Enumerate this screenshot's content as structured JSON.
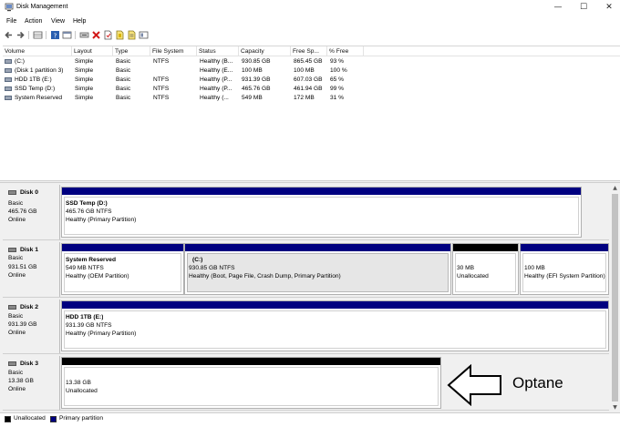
{
  "window": {
    "title": "Disk Management",
    "min_glyph": "—",
    "max_glyph": "☐",
    "close_glyph": "✕"
  },
  "menu": [
    "File",
    "Action",
    "View",
    "Help"
  ],
  "toolbar": {
    "icons": [
      "back-icon",
      "forward-icon",
      "disk-list-icon",
      "help-icon",
      "properties-icon",
      "connect-icon",
      "delete-icon",
      "new-icon",
      "rescan-icon",
      "refresh-icon",
      "settings-icon"
    ]
  },
  "volume_table": {
    "columns": [
      "Volume",
      "Layout",
      "Type",
      "File System",
      "Status",
      "Capacity",
      "Free Sp...",
      "% Free"
    ],
    "rows": [
      [
        "(C:)",
        "Simple",
        "Basic",
        "NTFS",
        "Healthy (B...",
        "930.85 GB",
        "865.45 GB",
        "93 %"
      ],
      [
        "(Disk 1 partition 3)",
        "Simple",
        "Basic",
        "",
        "Healthy (E...",
        "100 MB",
        "100 MB",
        "100 %"
      ],
      [
        "HDD 1TB (E:)",
        "Simple",
        "Basic",
        "NTFS",
        "Healthy (P...",
        "931.39 GB",
        "607.03 GB",
        "65 %"
      ],
      [
        "SSD Temp (D:)",
        "Simple",
        "Basic",
        "NTFS",
        "Healthy (P...",
        "465.76 GB",
        "461.94 GB",
        "99 %"
      ],
      [
        "System Reserved",
        "Simple",
        "Basic",
        "NTFS",
        "Healthy (...",
        "549 MB",
        "172 MB",
        "31 %"
      ]
    ]
  },
  "disks": [
    {
      "name": "Disk 0",
      "type": "Basic",
      "size": "465.76 GB",
      "status": "Online",
      "partitions": [
        {
          "title": "SSD Temp  (D:)",
          "line1": "465.76 GB NTFS",
          "line2": "Healthy (Primary Partition)"
        }
      ]
    },
    {
      "name": "Disk 1",
      "type": "Basic",
      "size": "931.51 GB",
      "status": "Online",
      "partitions": [
        {
          "title": "System Reserved",
          "line1": "549 MB NTFS",
          "line2": "Healthy (OEM Partition)"
        },
        {
          "title": "(C:)",
          "line1": "930.85 GB NTFS",
          "line2": "Healthy (Boot, Page File, Crash Dump, Primary Partition)"
        },
        {
          "title": "",
          "line1": "30 MB",
          "line2": "Unallocated"
        },
        {
          "title": "",
          "line1": "100 MB",
          "line2": "Healthy (EFI System Partition)"
        }
      ]
    },
    {
      "name": "Disk 2",
      "type": "Basic",
      "size": "931.39 GB",
      "status": "Online",
      "partitions": [
        {
          "title": "HDD 1TB  (E:)",
          "line1": "931.39 GB NTFS",
          "line2": "Healthy (Primary Partition)"
        }
      ]
    },
    {
      "name": "Disk 3",
      "type": "Basic",
      "size": "13.38 GB",
      "status": "Online",
      "partitions": [
        {
          "title": "",
          "line1": "13.38 GB",
          "line2": "Unallocated"
        }
      ]
    }
  ],
  "annotation": {
    "label": "Optane"
  },
  "legend": [
    {
      "label": "Unallocated",
      "color": "#000000"
    },
    {
      "label": "Primary partition",
      "color": "#000080"
    }
  ],
  "scrollbar": {
    "up_glyph": "▲",
    "down_glyph": "▼"
  },
  "colors": {
    "primary_partition": "#000080",
    "unallocated": "#000000"
  }
}
